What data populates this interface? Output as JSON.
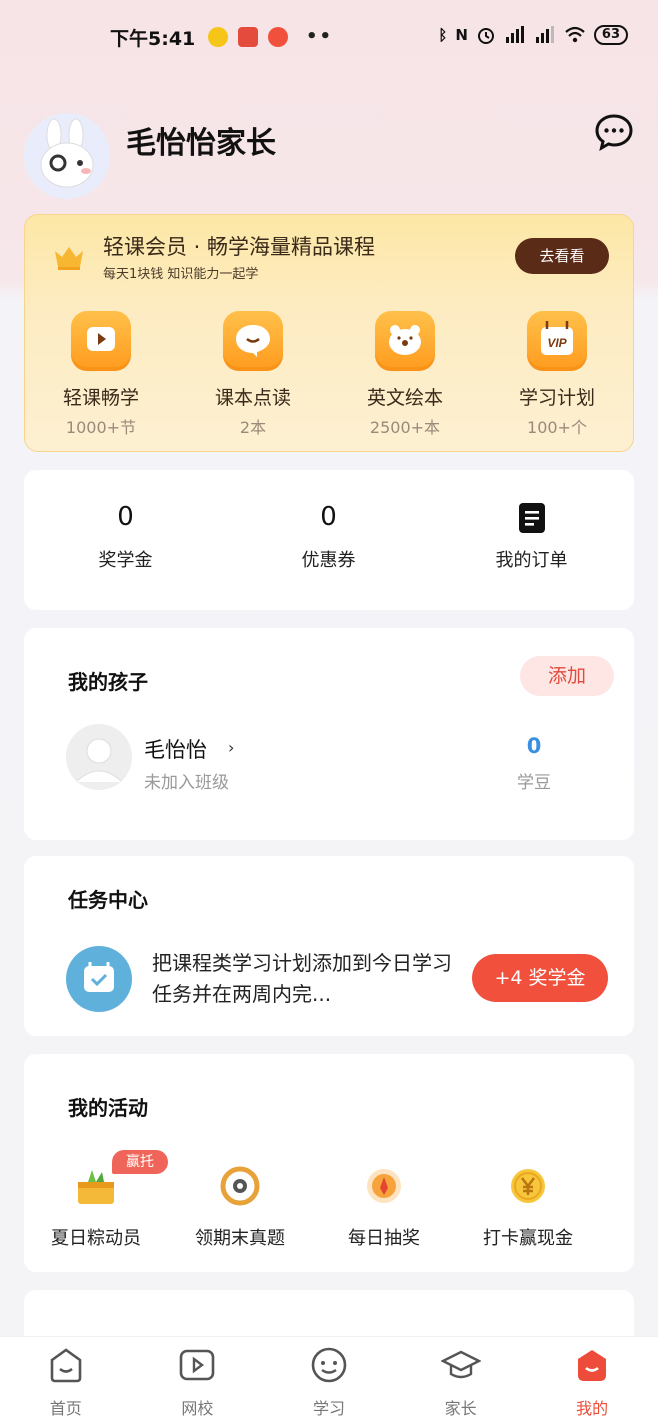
{
  "status_bar": {
    "time": "下午5:41",
    "left_icons": [
      "leaf-app-icon",
      "red-app-icon",
      "weibo-icon"
    ],
    "more": "••",
    "right_icons": [
      "bluetooth-icon",
      "nfc-icon",
      "alarm-icon",
      "hd-signal-icon",
      "signal-icon",
      "wifi-icon"
    ],
    "battery": "63"
  },
  "header": {
    "title": "毛怡怡家长",
    "message_icon": "chat-bubble-icon"
  },
  "vip": {
    "title": "轻课会员 · 畅学海量精品课程",
    "subtitle": "每天1块钱 知识能力一起学",
    "button": "去看看",
    "items": [
      {
        "label": "轻课畅学",
        "count": "1000+节",
        "icon": "play-video-icon"
      },
      {
        "label": "课本点读",
        "count": "2本",
        "icon": "speech-bubble-icon"
      },
      {
        "label": "英文绘本",
        "count": "2500+本",
        "icon": "bear-icon"
      },
      {
        "label": "学习计划",
        "count": "100+个",
        "icon": "vip-icon"
      }
    ],
    "vip_text": "VIP"
  },
  "stats": {
    "items": [
      {
        "value": "0",
        "label": "奖学金"
      },
      {
        "value": "0",
        "label": "优惠券"
      },
      {
        "label": "我的订单"
      }
    ]
  },
  "kids": {
    "title": "我的孩子",
    "add": "添加",
    "child": {
      "name": "毛怡怡",
      "chevron": "›",
      "class_status": "未加入班级",
      "beans": "0",
      "beans_label": "学豆"
    }
  },
  "tasks": {
    "title": "任务中心",
    "text": "把课程类学习计划添加到今日学习任务并在两周内完...",
    "button": "+4 奖学金"
  },
  "activities": {
    "title": "我的活动",
    "items": [
      {
        "label": "夏日粽动员",
        "badge": "赢托比"
      },
      {
        "label": "领期末真题"
      },
      {
        "label": "每日抽奖"
      },
      {
        "label": "打卡赢现金"
      }
    ]
  },
  "tabbar": {
    "tabs": [
      {
        "label": "首页"
      },
      {
        "label": "网校"
      },
      {
        "label": "学习"
      },
      {
        "label": "家长"
      },
      {
        "label": "我的"
      }
    ],
    "active": "我的"
  },
  "colors": {
    "accent_red": "#ee4c3a",
    "vip_brown": "#5a2b17",
    "beans_blue": "#3b8fe0",
    "orange": "#ff9b1e"
  }
}
